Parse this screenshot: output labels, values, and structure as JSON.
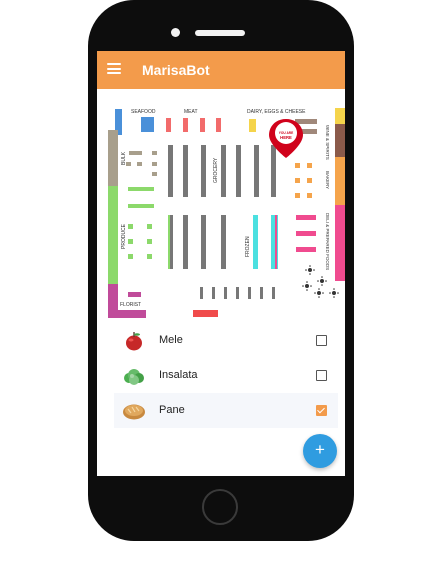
{
  "app": {
    "title": "MarisaBot"
  },
  "map": {
    "sections": {
      "seafood": "SEAFOOD",
      "meat": "MEAT",
      "dairy": "DAIRY, EGGS & CHEESE",
      "wine": "WINE & SPIRITS",
      "bakery": "BAKERY",
      "deli": "DELI & PREPARED FOODS",
      "bulk": "BULK",
      "grocery": "GROCERY",
      "produce": "PRODUCE",
      "frozen": "FROZEN",
      "florist": "FLORIST"
    },
    "marker": "YOU ARE HERE",
    "colors": {
      "seafood": "#4a90d9",
      "meat": "#f26b6b",
      "dairy": "#f5d44b",
      "wine": "#8b5a4a",
      "bakery": "#f5a44b",
      "deli": "#f04b8f",
      "bulk": "#a89f8c",
      "produce": "#8cd96b",
      "florist": "#c04b9a",
      "frozen": "#4be0e0",
      "aisle": "#777777",
      "marker": "#d0021b"
    }
  },
  "items": [
    {
      "label": "Mele",
      "icon": "apple-icon",
      "checked": false
    },
    {
      "label": "Insalata",
      "icon": "lettuce-icon",
      "checked": false
    },
    {
      "label": "Pane",
      "icon": "bread-icon",
      "checked": true
    }
  ],
  "fab": {
    "label": "+"
  }
}
